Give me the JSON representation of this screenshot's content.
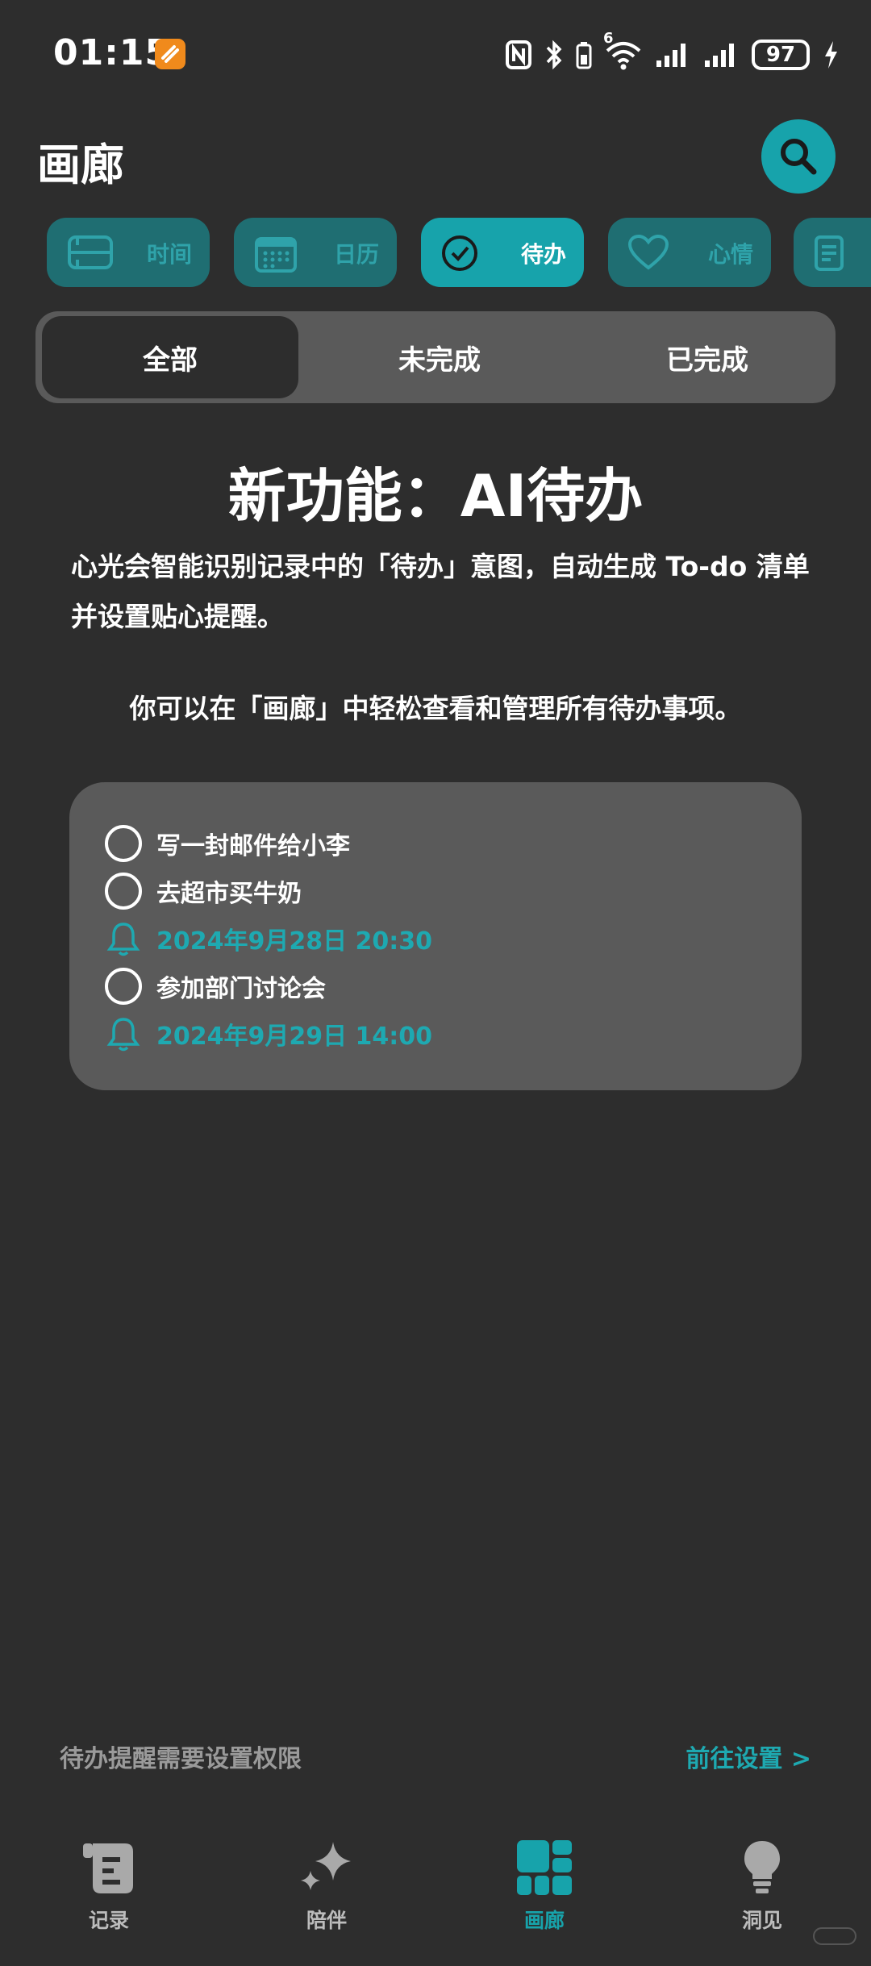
{
  "status_bar": {
    "time": "01:15",
    "battery": "97",
    "network_label": "6"
  },
  "header": {
    "title": "画廊",
    "search_icon": "search-icon"
  },
  "categories": [
    {
      "label": "时间",
      "icon": "timeline-icon",
      "active": false
    },
    {
      "label": "日历",
      "icon": "calendar-icon",
      "active": false
    },
    {
      "label": "待办",
      "icon": "check-circle-icon",
      "active": true
    },
    {
      "label": "心情",
      "icon": "heart-icon",
      "active": false
    },
    {
      "label": "",
      "icon": "notes-icon",
      "active": false
    }
  ],
  "filters": {
    "all": "全部",
    "incomplete": "未完成",
    "completed": "已完成",
    "selected": "全部"
  },
  "intro": {
    "title": "新功能：AI待办",
    "description": "心光会智能识别记录中的「待办」意图，自动生成 To-do 清单并设置贴心提醒。",
    "note": "你可以在「画廊」中轻松查看和管理所有待办事项。"
  },
  "sample_todos": [
    {
      "text": "写一封邮件给小李",
      "reminder": ""
    },
    {
      "text": "去超市买牛奶",
      "reminder": "2024年9月28日 20:30"
    },
    {
      "text": "参加部门讨论会",
      "reminder": "2024年9月29日 14:00"
    }
  ],
  "permission": {
    "text": "待办提醒需要设置权限",
    "link": "前往设置 >"
  },
  "bottom_nav": [
    {
      "label": "记录",
      "icon": "journal-icon",
      "active": false
    },
    {
      "label": "陪伴",
      "icon": "sparkle-icon",
      "active": false
    },
    {
      "label": "画廊",
      "icon": "gallery-icon",
      "active": true
    },
    {
      "label": "洞见",
      "icon": "lightbulb-icon",
      "active": false
    }
  ],
  "colors": {
    "background": "#2d2d2d",
    "accent": "#17a3ab",
    "card": "#5a5a5a",
    "chip_inactive": "#1f6e72"
  }
}
